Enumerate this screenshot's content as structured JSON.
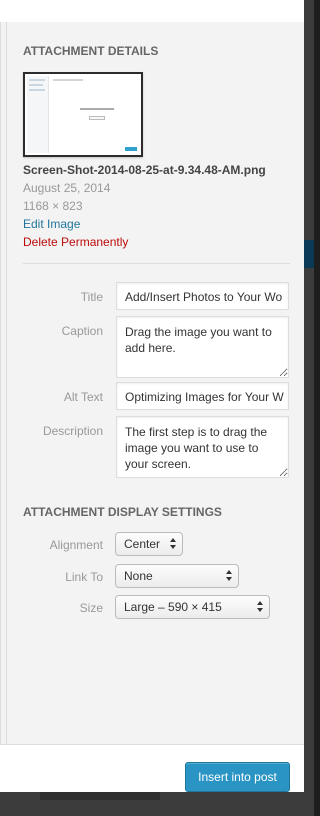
{
  "attachment_details": {
    "heading": "Attachment Details",
    "filename": "Screen-Shot-2014-08-25-at-9.34.48-AM.png",
    "date": "August 25, 2014",
    "dimensions": "1168 × 823",
    "edit_link": "Edit Image",
    "delete_link": "Delete Permanently"
  },
  "fields": {
    "title": {
      "label": "Title",
      "value": "Add/Insert Photos to Your Wo"
    },
    "caption": {
      "label": "Caption",
      "value": "Drag the image you want to add here."
    },
    "alt_text": {
      "label": "Alt Text",
      "value": "Optimizing Images for Your W"
    },
    "description": {
      "label": "Description",
      "value": "The first step is to drag the image you want to use to your screen."
    }
  },
  "display_settings": {
    "heading": "Attachment Display Settings",
    "alignment": {
      "label": "Alignment",
      "value": "Center"
    },
    "link_to": {
      "label": "Link To",
      "value": "None"
    },
    "size": {
      "label": "Size",
      "value": "Large – 590 × 415"
    }
  },
  "footer": {
    "insert_button": "Insert into post"
  },
  "colors": {
    "accent": "#2a95c5",
    "link": "#21759b",
    "danger": "#bc0b0b"
  }
}
